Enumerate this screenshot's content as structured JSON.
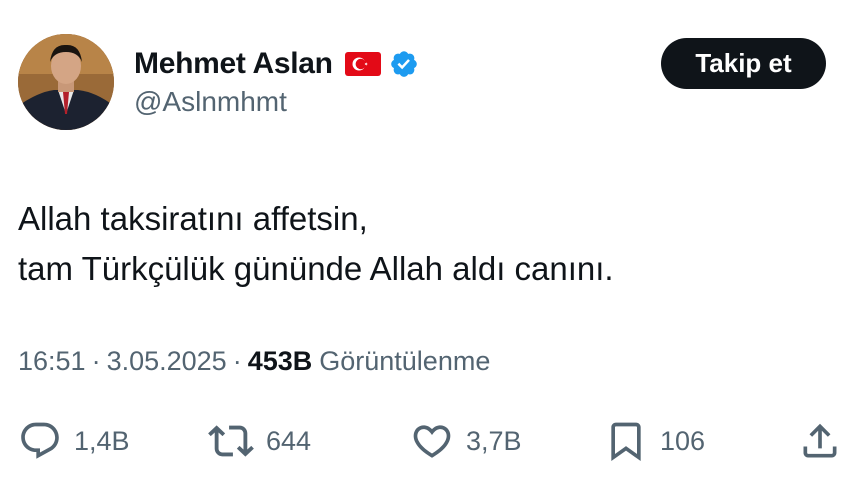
{
  "author": {
    "display_name": "Mehmet Aslan",
    "handle": "@Aslnmhmt",
    "flag_icon": "turkey-flag-icon",
    "verified_icon": "verified-badge-icon",
    "verified_color": "#1d9bf0"
  },
  "follow_button": {
    "label": "Takip et"
  },
  "tweet": {
    "lines": [
      "Allah taksiratını affetsin,",
      "tam Türkçülük gününde Allah aldı canını."
    ]
  },
  "meta": {
    "time": "16:51",
    "separator": "·",
    "date": "3.05.2025",
    "views_count": "453B",
    "views_label": "Görüntülenme"
  },
  "actions": {
    "reply": {
      "icon": "reply-icon",
      "count": "1,4B"
    },
    "retweet": {
      "icon": "retweet-icon",
      "count": "644"
    },
    "like": {
      "icon": "heart-icon",
      "count": "3,7B"
    },
    "bookmark": {
      "icon": "bookmark-icon",
      "count": "106"
    },
    "share": {
      "icon": "share-icon"
    }
  },
  "colors": {
    "text_primary": "#0f1419",
    "text_secondary": "#536471",
    "button_bg": "#0f1419",
    "flag_red": "#e30a17"
  }
}
